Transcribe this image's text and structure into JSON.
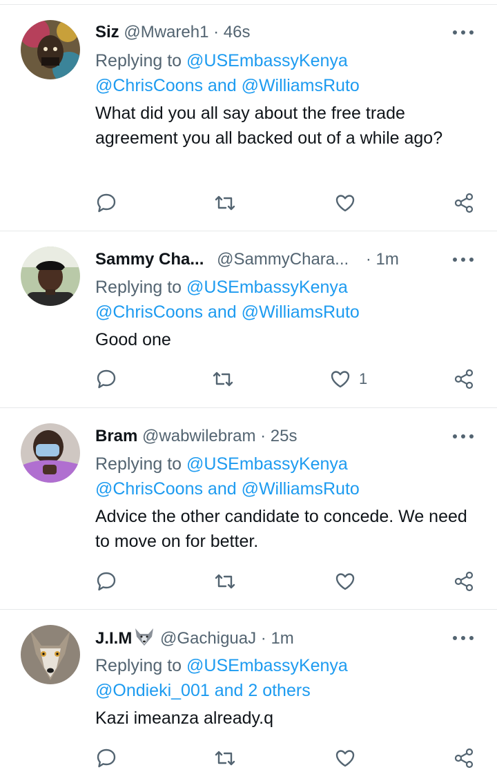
{
  "tweets": [
    {
      "name": "Siz",
      "handle": "@Mwareh1",
      "time": "· 46s",
      "replying_prefix": "Replying to ",
      "replying_first": "@USEmbassyKenya",
      "replying_second": "@ChrisCoons and @WilliamsRuto",
      "text": "What did you all say about the free trade agreement you all backed out of a while ago?",
      "likes": ""
    },
    {
      "name": "Sammy Cha...",
      "handle": "@SammyChara...",
      "time": "· 1m",
      "replying_prefix": "Replying to ",
      "replying_first": "@USEmbassyKenya",
      "replying_second": "@ChrisCoons and @WilliamsRuto",
      "text": "Good one",
      "likes": "1"
    },
    {
      "name": "Bram",
      "handle": "@wabwilebram",
      "time": "· 25s",
      "replying_prefix": "Replying to ",
      "replying_first": "@USEmbassyKenya",
      "replying_second": "@ChrisCoons and @WilliamsRuto",
      "text": "Advice the other candidate to concede. We need to move on for better.",
      "likes": ""
    },
    {
      "name": "J.I.M",
      "name_emoji": "wolf-emoji",
      "handle": "@GachiguaJ",
      "time": "· 1m",
      "replying_prefix": "Replying to ",
      "replying_first": "@USEmbassyKenya",
      "replying_second": "@Ondieki_001 and 2 others",
      "text": "Kazi imeanza already.q",
      "likes": ""
    }
  ],
  "icons": {
    "reply": "reply-bubble-icon",
    "retweet": "retweet-icon",
    "like": "heart-icon",
    "share": "share-icon",
    "more": "more-dots-icon"
  },
  "colors": {
    "link": "#1d9bf0",
    "secondary": "#536471",
    "text": "#0f1419"
  }
}
